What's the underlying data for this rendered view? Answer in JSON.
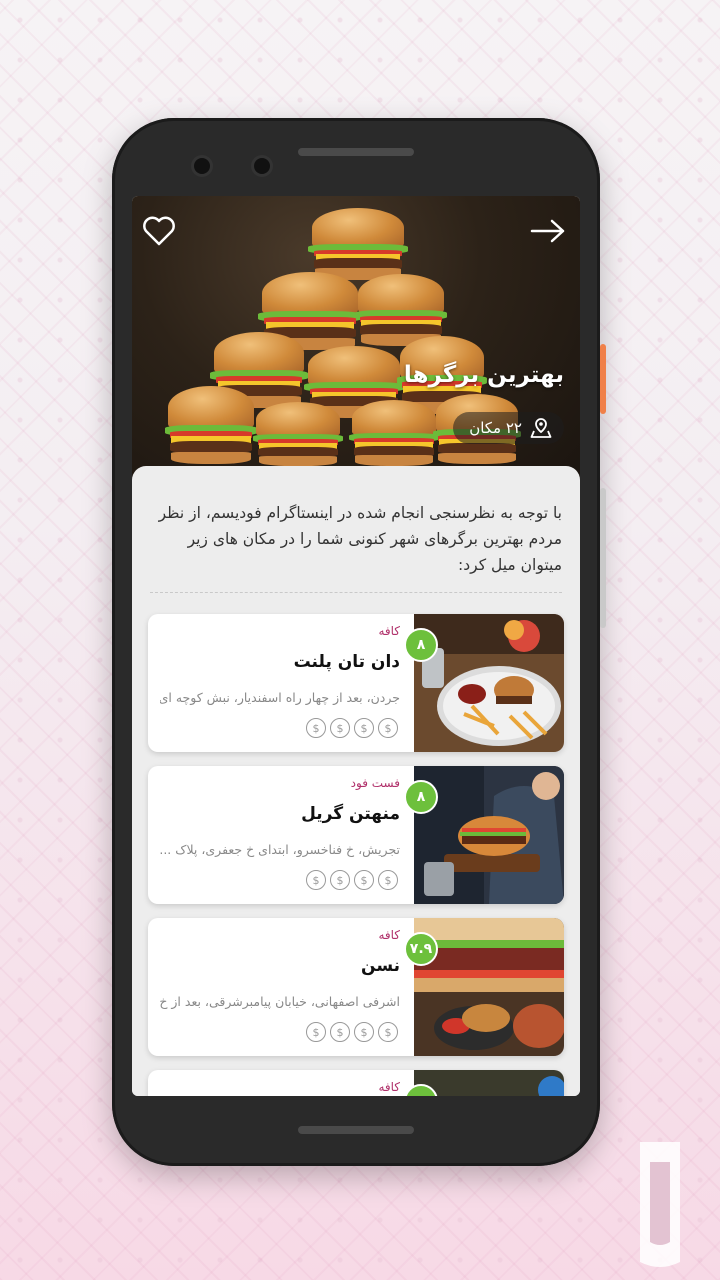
{
  "hero": {
    "title": "بهترین برگرها",
    "places_count": "۲۲ مکان",
    "back_icon": "arrow-right-icon",
    "favorite_icon": "heart-icon"
  },
  "intro_text": "با توجه به نظرسنجی انجام شده در اینستاگرام فودیسم، از نظر مردم بهترین برگرهای شهر کنونی شما را در مکان های زیر میتوان میل کرد:",
  "places": [
    {
      "category": "کافه",
      "name": "دان تان پلنت",
      "address": "جردن، بعد از چهار راه اسفندیار، نبش کوچه ای..",
      "score": "۸",
      "price": [
        "$",
        "$",
        "$",
        "$"
      ]
    },
    {
      "category": "فست فود",
      "name": "منهتن گریل",
      "address": "تجریش، خ فناخسرو، ابتدای خ جعفری، پلاک ...",
      "score": "۸",
      "price": [
        "$",
        "$",
        "$",
        "$"
      ]
    },
    {
      "category": "کافه",
      "name": "نسن",
      "address": "اشرفی اصفهانی، خیابان پیامبرشرقی، بعد از خ...",
      "score": "۷.۹",
      "price": [
        "$",
        "$",
        "$",
        "$"
      ]
    },
    {
      "category": "کافه"
    }
  ],
  "colors": {
    "accent": "#b0306a",
    "score_green": "#6dc03c",
    "phone": "#2a2a2a"
  }
}
